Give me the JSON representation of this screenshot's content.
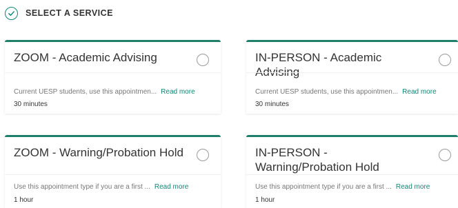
{
  "header": {
    "title": "SELECT A SERVICE",
    "icon": "check-circle-icon",
    "accent_color": "#108575"
  },
  "services": [
    {
      "title": "ZOOM - Academic Advising",
      "description": "Current UESP students, use this appointmen...",
      "read_more": "Read more",
      "duration": "30 minutes",
      "selected": false
    },
    {
      "title": "IN-PERSON - Academic Advising",
      "description": "Current UESP students, use this appointmen...",
      "read_more": "Read more",
      "duration": "30 minutes",
      "selected": false
    },
    {
      "title": "ZOOM - Warning/Probation Hold",
      "description": "Use this appointment type if you are a first ...",
      "read_more": "Read more",
      "duration": "1 hour",
      "selected": false
    },
    {
      "title": "IN-PERSON - Warning/Probation Hold",
      "description": "Use this appointment type if you are a first ...",
      "read_more": "Read more",
      "duration": "1 hour",
      "selected": false
    }
  ],
  "colors": {
    "card_top_border": "#1d7f69",
    "link": "#108575"
  }
}
